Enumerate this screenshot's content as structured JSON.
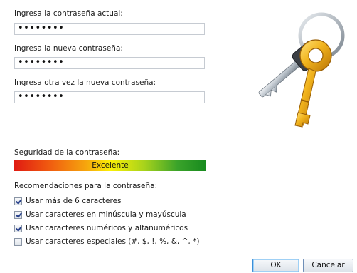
{
  "form": {
    "current_password_label": "Ingresa la contraseña actual:",
    "current_password_value": "••••••••",
    "new_password_label": "Ingresa la nueva contraseña:",
    "new_password_value": "••••••••",
    "confirm_password_label": "Ingresa otra vez la nueva contraseña:",
    "confirm_password_value": "••••••••"
  },
  "strength": {
    "label": "Seguridad de la contraseña:",
    "value_text": "Excelente"
  },
  "recommendations": {
    "title": "Recomendaciones para la contraseña:",
    "items": [
      {
        "label": "Usar más de 6 caracteres",
        "checked": true
      },
      {
        "label": "Usar caracteres en minúscula y mayúscula",
        "checked": true
      },
      {
        "label": "Usar caracteres numéricos y alfanuméricos",
        "checked": true
      },
      {
        "label": "Usar caracteres especiales (#, $, !, %, &, ^, *)",
        "checked": false
      }
    ]
  },
  "buttons": {
    "ok_label": "OK",
    "cancel_label": "Cancelar"
  },
  "icons": {
    "keys": "keys-icon"
  }
}
